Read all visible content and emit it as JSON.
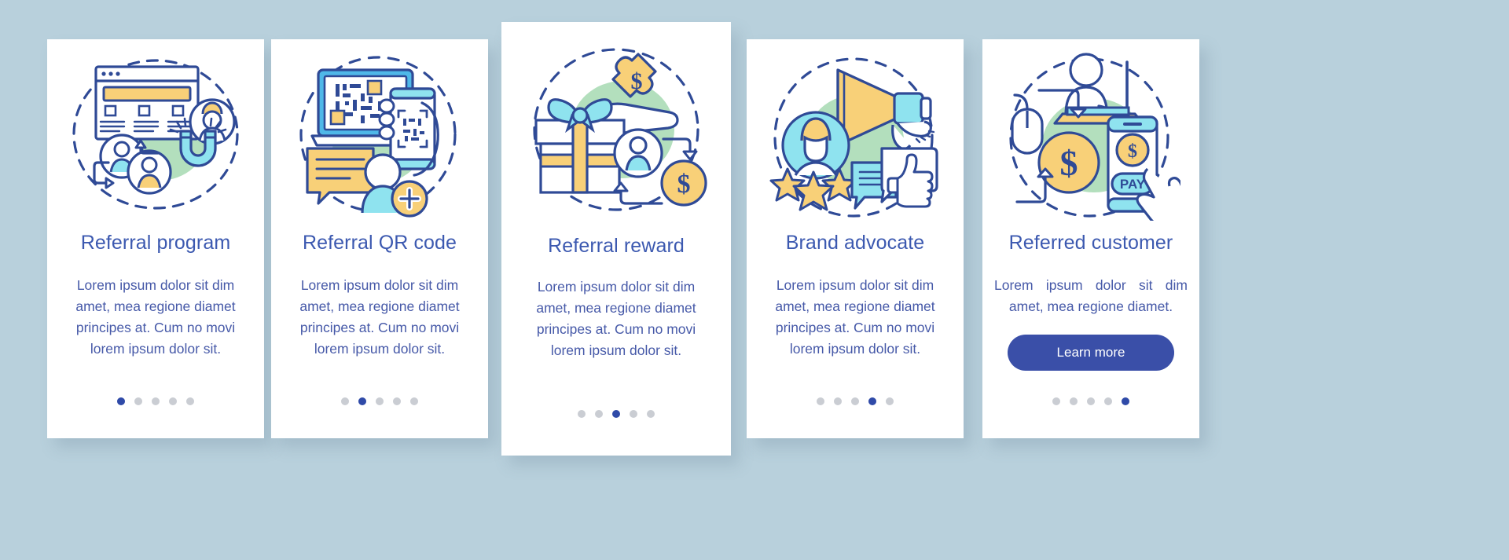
{
  "theme": {
    "background": "#b8d0dc",
    "card_background": "#ffffff",
    "title_color": "#3c59b0",
    "body_color": "#4659a8",
    "accent": "#2f4aa8",
    "dot_inactive": "#cacdd3",
    "illus_outline": "#2f4a96",
    "illus_yellow": "#f8d078",
    "illus_cyan": "#8fe3ef",
    "illus_blue": "#4fb8e8",
    "illus_green_blob": "#b3dfbd"
  },
  "cards": [
    {
      "title": "Referral program",
      "body": "Lorem ipsum dolor sit dim amet, mea regione diamet principes at. Cum no movi lorem ipsum dolor sit.",
      "illustration": "referral-program-illustration",
      "dots": {
        "count": 5,
        "active_index": 0
      },
      "cta": null
    },
    {
      "title": "Referral QR code",
      "body": "Lorem ipsum dolor sit dim amet, mea regione diamet principes at. Cum no movi lorem ipsum dolor sit.",
      "illustration": "referral-qr-code-illustration",
      "dots": {
        "count": 5,
        "active_index": 1
      },
      "cta": null
    },
    {
      "title": "Referral reward",
      "body": "Lorem ipsum dolor sit dim amet, mea regione diamet principes at. Cum no movi lorem ipsum dolor sit.",
      "illustration": "referral-reward-illustration",
      "dots": {
        "count": 5,
        "active_index": 2
      },
      "cta": null
    },
    {
      "title": "Brand advocate",
      "body": "Lorem ipsum dolor sit dim amet, mea regione diamet principes at. Cum no movi lorem ipsum dolor sit.",
      "illustration": "brand-advocate-illustration",
      "dots": {
        "count": 5,
        "active_index": 3
      },
      "cta": null
    },
    {
      "title": "Referred customer",
      "body": "Lorem ipsum dolor sit dim amet, mea regione diamet.",
      "illustration": "referred-customer-illustration",
      "dots": {
        "count": 5,
        "active_index": 4
      },
      "cta": "Learn more"
    }
  ],
  "illustration_labels": {
    "pay_button": "PAY",
    "dollar_sign": "$"
  }
}
